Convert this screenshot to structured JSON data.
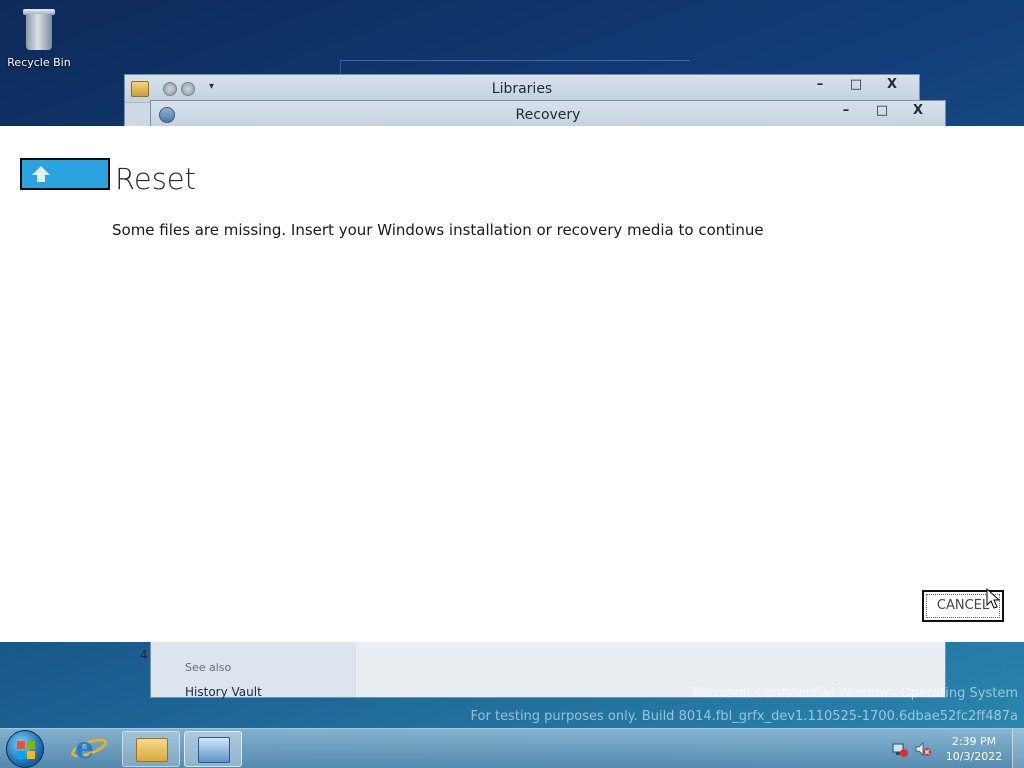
{
  "desktop": {
    "recycle_bin_label": "Recycle Bin"
  },
  "windows": {
    "libraries_title": "Libraries",
    "recovery_title": "Recovery",
    "minimize_glyph": "–",
    "maximize_glyph": "□",
    "close_glyph": "X",
    "recovery_sidebar": {
      "see_also_label": "See also",
      "history_link": "History Vault"
    },
    "partial_number": "4"
  },
  "dialog": {
    "title": "Reset",
    "message": "Some files are missing. Insert your Windows installation or recovery media to continue",
    "back_icon": "up-arrow-icon",
    "cancel_label": "CANCEL",
    "accent_color": "#2aa3e0"
  },
  "watermark": {
    "line1": "Microsoft Confidential Windows Operating System",
    "line2": "For testing purposes only. Build 8014.fbl_grfx_dev1.110525-1700.6dbae52fc2ff487a"
  },
  "taskbar": {
    "items": [
      "start-orb",
      "internet-explorer-icon",
      "windows-explorer-icon",
      "control-panel-icon"
    ],
    "clock_time": "2:39 PM",
    "clock_date": "10/3/2022"
  }
}
